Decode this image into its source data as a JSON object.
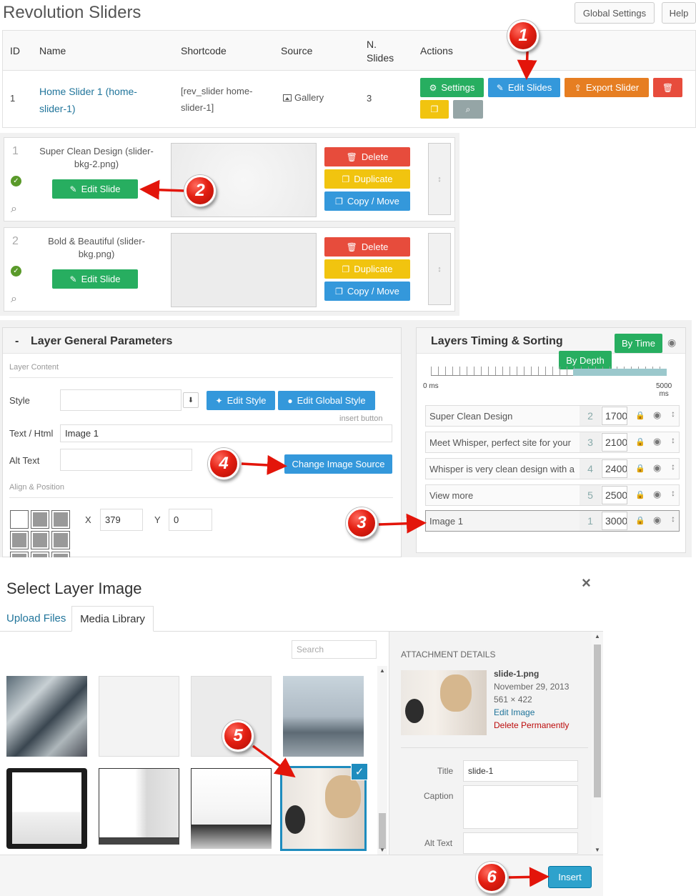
{
  "header": {
    "title": "Revolution Sliders",
    "global_settings": "Global Settings",
    "help": "Help"
  },
  "slider_table": {
    "columns": [
      "ID",
      "Name",
      "Shortcode",
      "Source",
      "N.",
      "Slides",
      "Actions"
    ],
    "row": {
      "id": "1",
      "name_line1": "Home Slider 1 (home-",
      "name_line2": "slider-1)",
      "shortcode_line1": "[rev_slider home-",
      "shortcode_line2": "slider-1]",
      "source": "Gallery",
      "slides": "3"
    },
    "actions": {
      "settings": "Settings",
      "edit_slides": "Edit Slides",
      "export_slider": "Export Slider"
    }
  },
  "slides": [
    {
      "num": "1",
      "title_line1": "Super Clean Design (slider-",
      "title_line2": "bkg-2.png)",
      "edit": "Edit Slide",
      "delete": "Delete",
      "duplicate": "Duplicate",
      "copy_move": "Copy / Move"
    },
    {
      "num": "2",
      "title_line1": "Bold & Beautiful (slider-",
      "title_line2": "bkg.png)",
      "edit": "Edit Slide",
      "delete": "Delete",
      "duplicate": "Duplicate",
      "copy_move": "Copy / Move"
    }
  ],
  "layer_params": {
    "title": "Layer General Parameters",
    "collapse": "-",
    "layer_content": "Layer Content",
    "style_label": "Style",
    "style_value": "",
    "edit_style": "Edit Style",
    "edit_global_style": "Edit Global Style",
    "insert_button": "insert button",
    "text_label": "Text / Html",
    "text_value": "Image 1",
    "alt_label": "Alt Text",
    "alt_value": "",
    "change_image": "Change Image Source",
    "align_label": "Align & Position",
    "x_label": "X",
    "x_value": "379",
    "y_label": "Y",
    "y_value": "0"
  },
  "timing": {
    "title": "Layers Timing & Sorting",
    "by_time": "By Time",
    "by_depth": "By Depth",
    "start": "0 ms",
    "end_line1": "5000",
    "end_line2": "ms",
    "layers": [
      {
        "name": "Super Clean Design",
        "idx": "2",
        "ms": "1700"
      },
      {
        "name": "Meet Whisper, perfect site for your",
        "idx": "3",
        "ms": "2100"
      },
      {
        "name": "Whisper is very clean design with a",
        "idx": "4",
        "ms": "2400"
      },
      {
        "name": "View more",
        "idx": "5",
        "ms": "2500"
      },
      {
        "name": "Image 1",
        "idx": "1",
        "ms": "3000"
      }
    ]
  },
  "modal": {
    "title": "Select Layer Image",
    "close": "×",
    "tab_upload": "Upload Files",
    "tab_library": "Media Library",
    "search_placeholder": "Search",
    "details_heading": "ATTACHMENT DETAILS",
    "file_name": "slide-1.png",
    "file_date": "November 29, 2013",
    "file_dims": "561 × 422",
    "edit_image": "Edit Image",
    "delete_permanently": "Delete Permanently",
    "title_label": "Title",
    "title_value": "slide-1",
    "caption_label": "Caption",
    "caption_value": "",
    "alt_label": "Alt Text",
    "alt_value": "",
    "insert": "Insert"
  },
  "markers": [
    "1",
    "2",
    "3",
    "4",
    "5",
    "6"
  ],
  "colors": {
    "green": "#27ae60",
    "blue": "#3498db",
    "orange": "#e67e22",
    "red": "#e74c3c",
    "yellow": "#f1c40f",
    "gray": "#95a5a6",
    "link": "#21759b",
    "arrow": "#e3150a"
  }
}
